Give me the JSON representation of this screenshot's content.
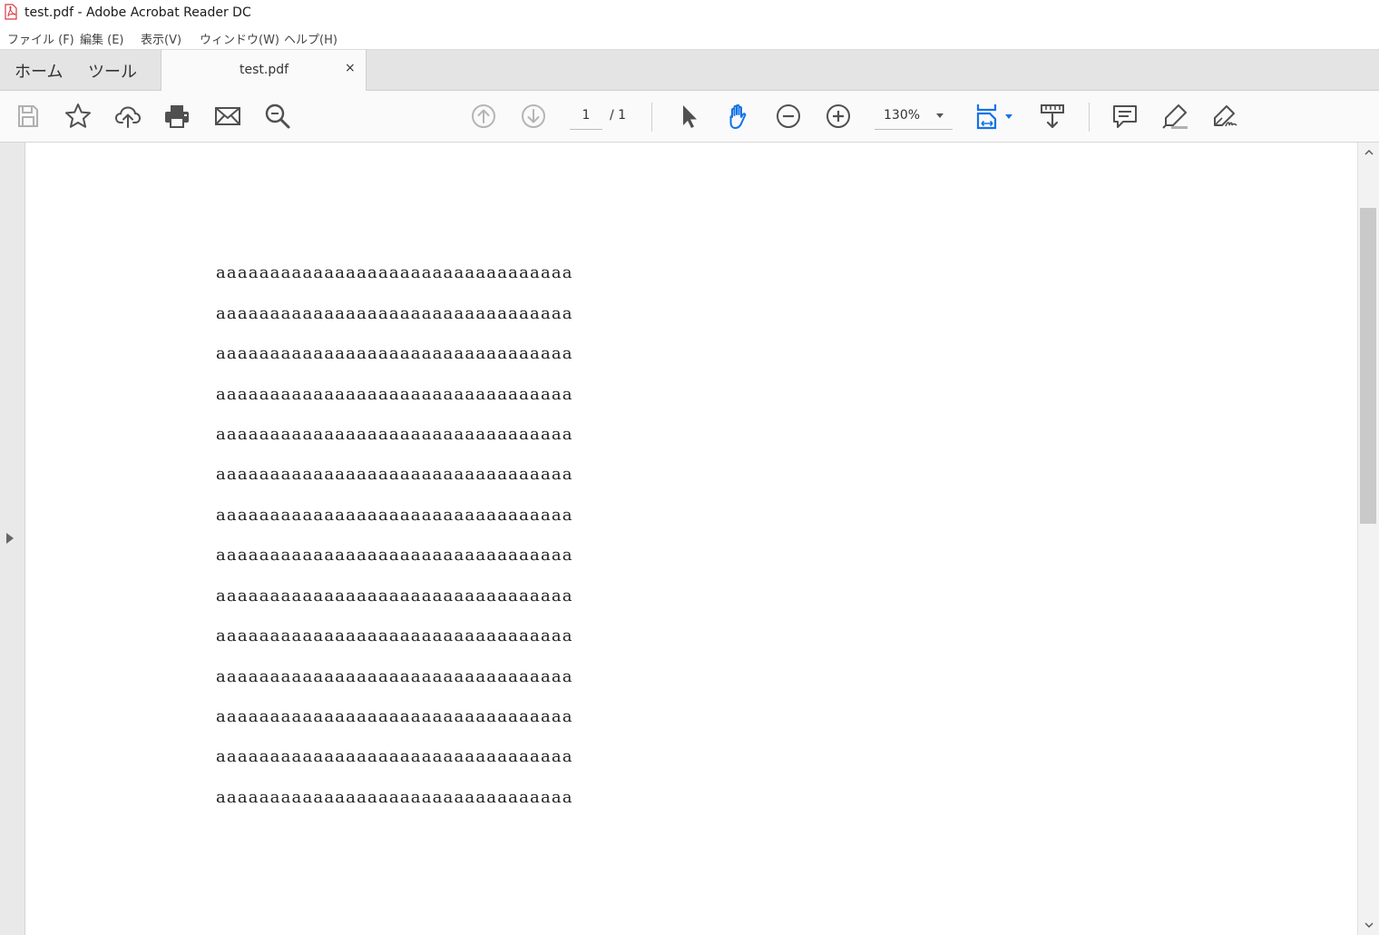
{
  "window": {
    "title": "test.pdf - Adobe Acrobat Reader DC"
  },
  "menubar": {
    "items": [
      "ファイル (F)",
      "編集 (E)",
      "表示(V)",
      "ウィンドウ(W)",
      "ヘルプ(H)"
    ]
  },
  "tabs": {
    "home": "ホーム",
    "tools": "ツール",
    "document": "test.pdf",
    "close": "×"
  },
  "toolbar": {
    "icons": [
      "save-icon",
      "star-icon",
      "cloud-upload-icon",
      "print-icon",
      "mail-icon",
      "search-zoom-icon",
      "page-up-icon",
      "page-down-icon",
      "select-cursor-icon",
      "hand-tool-icon",
      "zoom-out-icon",
      "zoom-in-icon",
      "fit-page-icon",
      "scroll-mode-icon",
      "comment-icon",
      "highlight-icon",
      "sign-icon"
    ],
    "current_page": "1",
    "total_pages": "/ 1",
    "zoom": "130%",
    "accent_color": "#1473e6"
  },
  "document": {
    "lines": [
      "aaaaaaaaaaaaaaaaaaaaaaaaaaaaaaaaa",
      "aaaaaaaaaaaaaaaaaaaaaaaaaaaaaaaaa",
      "aaaaaaaaaaaaaaaaaaaaaaaaaaaaaaaaa",
      "aaaaaaaaaaaaaaaaaaaaaaaaaaaaaaaaa",
      "aaaaaaaaaaaaaaaaaaaaaaaaaaaaaaaaa",
      "aaaaaaaaaaaaaaaaaaaaaaaaaaaaaaaaa",
      "aaaaaaaaaaaaaaaaaaaaaaaaaaaaaaaaa",
      "aaaaaaaaaaaaaaaaaaaaaaaaaaaaaaaaa",
      "aaaaaaaaaaaaaaaaaaaaaaaaaaaaaaaaa",
      "aaaaaaaaaaaaaaaaaaaaaaaaaaaaaaaaa",
      "aaaaaaaaaaaaaaaaaaaaaaaaaaaaaaaaa",
      "aaaaaaaaaaaaaaaaaaaaaaaaaaaaaaaaa",
      "aaaaaaaaaaaaaaaaaaaaaaaaaaaaaaaaa",
      "aaaaaaaaaaaaaaaaaaaaaaaaaaaaaaaaa"
    ]
  }
}
